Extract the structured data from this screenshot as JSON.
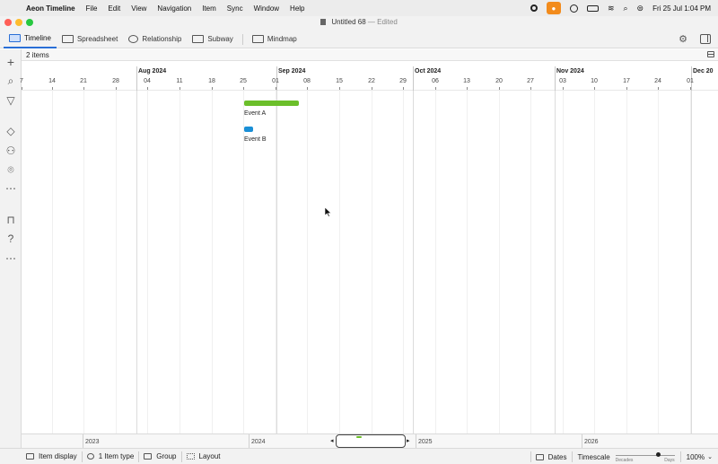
{
  "menubar": {
    "app_name": "Aeon Timeline",
    "items": [
      "File",
      "Edit",
      "View",
      "Navigation",
      "Item",
      "Sync",
      "Window",
      "Help"
    ],
    "clock": "Fri 25 Jul  1:04 PM"
  },
  "window": {
    "title": "Untitled 68",
    "title_sep": "—",
    "status": "Edited"
  },
  "toolbar": {
    "tabs": [
      {
        "label": "Timeline",
        "icon": "timeline-icon",
        "active": true
      },
      {
        "label": "Spreadsheet",
        "icon": "spreadsheet-icon",
        "active": false
      },
      {
        "label": "Relationship",
        "icon": "relationship-icon",
        "active": false
      },
      {
        "label": "Subway",
        "icon": "subway-icon",
        "active": false
      },
      {
        "label": "Mindmap",
        "icon": "mindmap-icon",
        "active": false
      }
    ]
  },
  "itemsbar": {
    "count": "2 items"
  },
  "ruler": {
    "months": [
      "Aug 2024",
      "Sep 2024",
      "Oct 2024",
      "Nov 2024",
      "Dec 20"
    ],
    "days": [
      "7",
      "14",
      "21",
      "28",
      "04",
      "11",
      "18",
      "25",
      "01",
      "08",
      "15",
      "22",
      "29",
      "06",
      "13",
      "20",
      "27",
      "03",
      "10",
      "17",
      "24",
      "01"
    ]
  },
  "events": [
    {
      "name": "Event A",
      "color": "#6bbf2a"
    },
    {
      "name": "Event B",
      "color": "#1a8fd6"
    }
  ],
  "overview": {
    "years": [
      "2023",
      "2024",
      "2025",
      "2026"
    ],
    "prev_glyph": "◂",
    "next_glyph": "▸"
  },
  "statusbar": {
    "item_display": "Item display",
    "item_type": "1 Item type",
    "group": "Group",
    "layout": "Layout",
    "dates": "Dates",
    "timescale": "Timescale",
    "slider_min": "Decades",
    "slider_max": "Days",
    "timescale_level": 0.72,
    "zoom": "100%"
  },
  "colors": {
    "accent": "#2a6fd6",
    "event_a": "#6bbf2a",
    "event_b": "#1a8fd6"
  }
}
